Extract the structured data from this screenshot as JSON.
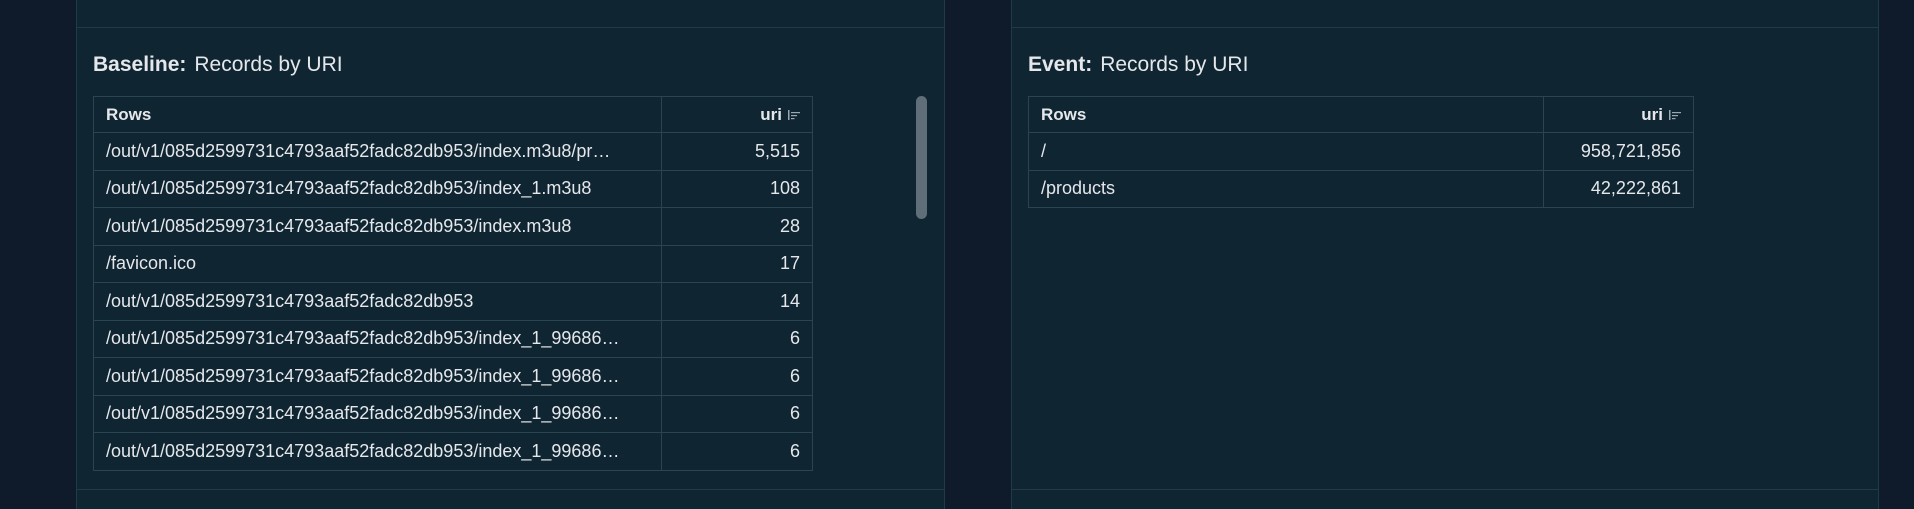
{
  "baseline": {
    "title_label": "Baseline",
    "title_sep": ":",
    "title_name": "Records by URI",
    "header_rows": "Rows",
    "header_value": "uri",
    "rows": [
      {
        "uri": "/out/v1/085d2599731c4793aaf52fadc82db953/index.m3u8/pr…",
        "count": "5,515"
      },
      {
        "uri": "/out/v1/085d2599731c4793aaf52fadc82db953/index_1.m3u8",
        "count": "108"
      },
      {
        "uri": "/out/v1/085d2599731c4793aaf52fadc82db953/index.m3u8",
        "count": "28"
      },
      {
        "uri": "/favicon.ico",
        "count": "17"
      },
      {
        "uri": "/out/v1/085d2599731c4793aaf52fadc82db953",
        "count": "14"
      },
      {
        "uri": "/out/v1/085d2599731c4793aaf52fadc82db953/index_1_99686…",
        "count": "6"
      },
      {
        "uri": "/out/v1/085d2599731c4793aaf52fadc82db953/index_1_99686…",
        "count": "6"
      },
      {
        "uri": "/out/v1/085d2599731c4793aaf52fadc82db953/index_1_99686…",
        "count": "6"
      },
      {
        "uri": "/out/v1/085d2599731c4793aaf52fadc82db953/index_1_99686…",
        "count": "6"
      }
    ]
  },
  "event": {
    "title_label": "Event",
    "title_sep": ":",
    "title_name": "Records by URI",
    "header_rows": "Rows",
    "header_value": "uri",
    "rows": [
      {
        "uri": "/",
        "count": "958,721,856"
      },
      {
        "uri": "/products",
        "count": "42,222,861"
      }
    ]
  },
  "icons": {
    "sort": "sort-icon"
  }
}
